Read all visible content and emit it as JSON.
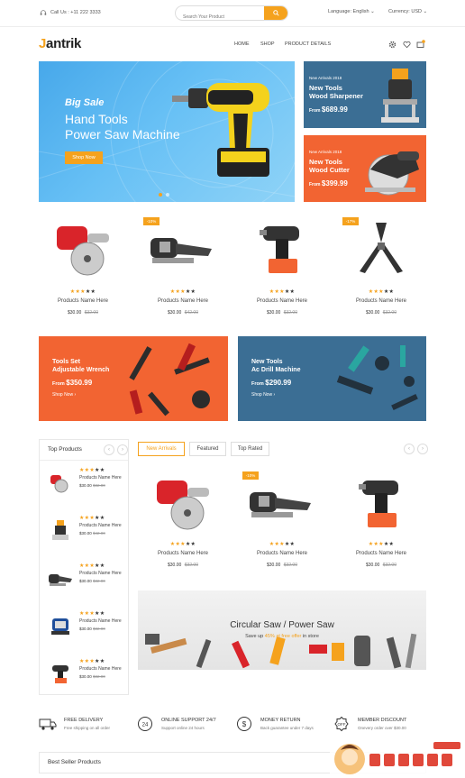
{
  "topbar": {
    "phone": "Call Us : +11 222 3333",
    "search_placeholder": "Search Your Product",
    "language": "Language: English",
    "currency": "Currency: USD"
  },
  "header": {
    "logo_first": "J",
    "logo_rest": "antrik",
    "nav": [
      "HOME",
      "SHOP",
      "PRODUCT DETAILS"
    ],
    "cart_count": "0"
  },
  "hero": {
    "tagline": "Big Sale",
    "line1": "Hand Tools",
    "line2": "Power Saw Machine",
    "button": "Shop Now"
  },
  "side_banners": [
    {
      "kicker": "New Arrivals 2018",
      "line1": "New Tools",
      "line2": "Wood Sharpener",
      "from": "From",
      "price": "$689.99",
      "color": "#3b6e94"
    },
    {
      "kicker": "New Arrivals 2018",
      "line1": "New Tools",
      "line2": "Wood Cutter",
      "from": "From",
      "price": "$399.99",
      "color": "#f26432"
    }
  ],
  "products_row": [
    {
      "name": "Products Name Here",
      "price": "$30.00",
      "old": "$32.00",
      "badge": "",
      "stars": 3
    },
    {
      "name": "Products Name Here",
      "price": "$30.00",
      "old": "$42.00",
      "badge": "-10%",
      "stars": 3
    },
    {
      "name": "Products Name Here",
      "price": "$30.00",
      "old": "$32.00",
      "badge": "",
      "stars": 3
    },
    {
      "name": "Products Name Here",
      "price": "$30.00",
      "old": "$32.00",
      "badge": "-17%",
      "stars": 3
    }
  ],
  "promo_banners": [
    {
      "line1": "Tools Set",
      "line2": "Adjustable Wrench",
      "from": "From",
      "price": "$350.99",
      "shop": "Shop Now",
      "color": "#f26432"
    },
    {
      "line1": "New Tools",
      "line2": "Ac Drill Machine",
      "from": "From",
      "price": "$290.99",
      "shop": "Shop Now",
      "color": "#3b6e94"
    }
  ],
  "top_products": {
    "title": "Top Products",
    "items": [
      {
        "name": "Products Name Here",
        "price": "$30.00",
        "old": "$32.00"
      },
      {
        "name": "Products Name Here",
        "price": "$30.00",
        "old": "$42.00"
      },
      {
        "name": "Products Name Here",
        "price": "$30.00",
        "old": "$32.00"
      },
      {
        "name": "Products Name Here",
        "price": "$30.00",
        "old": "$32.00"
      },
      {
        "name": "Products Name Here",
        "price": "$30.00",
        "old": "$32.00"
      }
    ]
  },
  "tabs": [
    "New Arrivals",
    "Featured",
    "Top Rated"
  ],
  "tab_products": [
    {
      "name": "Products Name Here",
      "price": "$30.00",
      "old": "$32.00",
      "badge": ""
    },
    {
      "name": "Products Name Here",
      "price": "$30.00",
      "old": "$32.00",
      "badge": "-10%"
    },
    {
      "name": "Products Name Here",
      "price": "$30.00",
      "old": "$32.00",
      "badge": ""
    }
  ],
  "saw_banner": {
    "title": "Circular Saw / Power Saw",
    "sub_pre": "Save up",
    "sub_hl": "45% at free offer",
    "sub_post": "in store"
  },
  "features": [
    {
      "title": "FREE DELIVERY",
      "desc": "Free shipping on all order"
    },
    {
      "title": "ONLINE SUPPORT 24/7",
      "desc": "Support online 24 hours"
    },
    {
      "title": "MONEY RETURN",
      "desc": "Back guarantee under 7 days"
    },
    {
      "title": "MEMBER DISCOUNT",
      "desc": "Onevery order over $30.00"
    }
  ],
  "bestseller": {
    "title": "Best Seller Products"
  },
  "colors": {
    "accent": "#f5a21d",
    "orange": "#f26432",
    "blue": "#3b6e94"
  }
}
